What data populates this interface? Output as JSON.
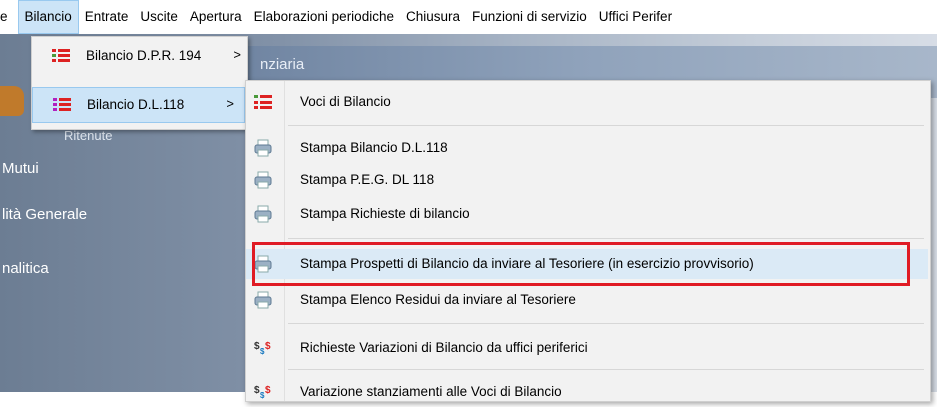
{
  "menubar": {
    "items": [
      {
        "label": "e"
      },
      {
        "label": "Bilancio"
      },
      {
        "label": "Entrate"
      },
      {
        "label": "Uscite"
      },
      {
        "label": "Apertura"
      },
      {
        "label": "Elaborazioni periodiche"
      },
      {
        "label": "Chiusura"
      },
      {
        "label": "Funzioni di servizio"
      },
      {
        "label": "Uffici Perifer"
      }
    ]
  },
  "background": {
    "banner_text": "nziaria",
    "ritenute": "Ritenute",
    "mutui": "Mutui",
    "contabilita": "lità Generale",
    "analitica": "nalitica"
  },
  "dropdown": {
    "items": [
      {
        "label": "Bilancio D.P.R. 194",
        "arrow": ">",
        "icon": "list-icon"
      },
      {
        "label": "Bilancio D.L.118",
        "arrow": ">",
        "icon": "list-icon"
      }
    ]
  },
  "submenu": {
    "items": [
      {
        "label": "Voci di Bilancio",
        "icon": "list-icon"
      },
      {
        "label": "Stampa Bilancio D.L.118",
        "icon": "print-icon"
      },
      {
        "label": "Stampa P.E.G.  DL 118",
        "icon": "print-icon"
      },
      {
        "label": "Stampa Richieste di bilancio",
        "icon": "print-icon"
      },
      {
        "label": "Stampa Prospetti di Bilancio da inviare al Tesoriere (in esercizio provvisorio)",
        "icon": "print-icon"
      },
      {
        "label": "Stampa Elenco Residui da inviare al Tesoriere",
        "icon": "print-icon"
      },
      {
        "label": "Richieste Variazioni di Bilancio da uffici periferici",
        "icon": "dollar-icon"
      },
      {
        "label": "Variazione stanziamenti alle Voci di Bilancio",
        "icon": "dollar-icon"
      }
    ]
  },
  "colors": {
    "highlight": "#cce4f7",
    "annotation_box": "#e01b24"
  }
}
